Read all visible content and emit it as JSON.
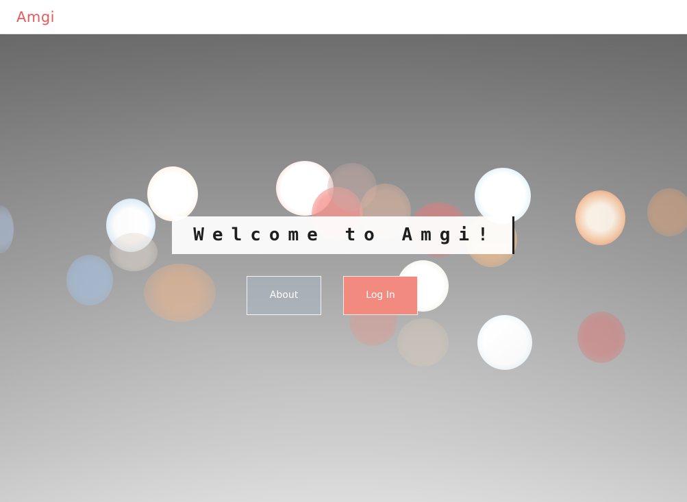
{
  "navbar": {
    "brand": "Amgi"
  },
  "hero": {
    "welcome_text": "Welcome to Amgi!",
    "about_label": "About",
    "login_label": "Log In"
  },
  "colors": {
    "brand": "#e85a5a",
    "login_button": "#f28a7f",
    "welcome_text": "#1e1e1e"
  }
}
